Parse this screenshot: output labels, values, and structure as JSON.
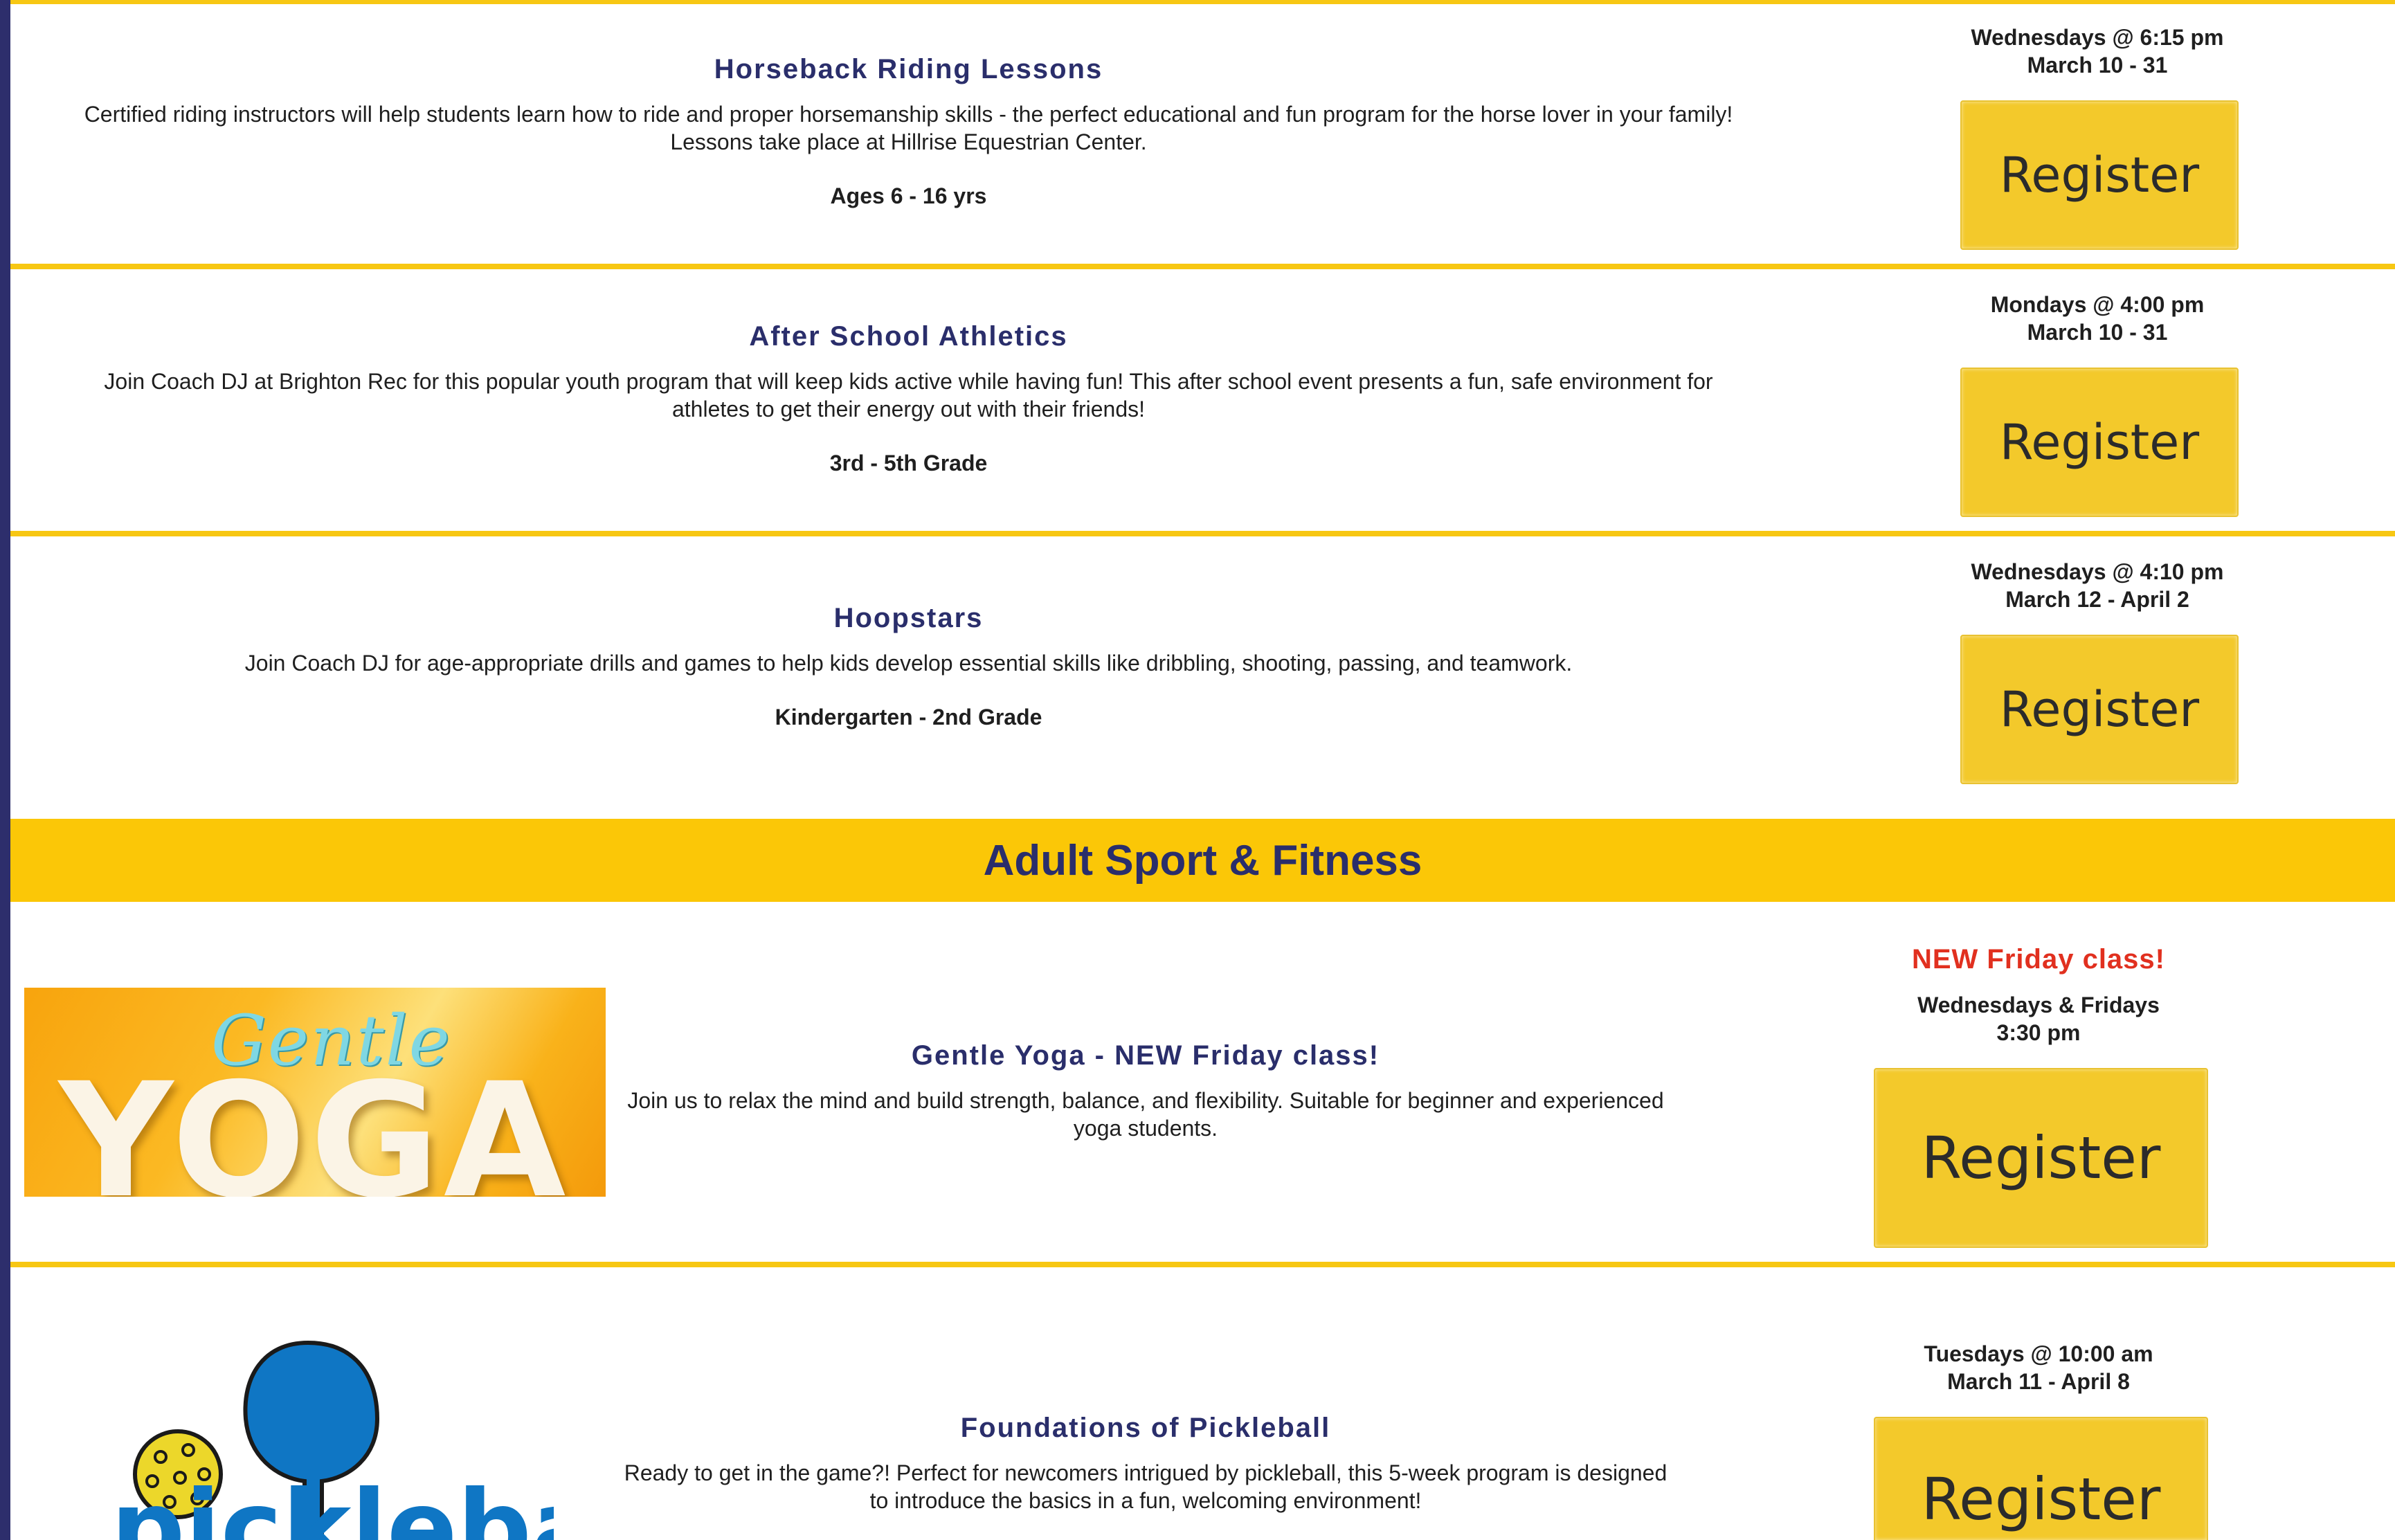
{
  "colors": {
    "accent_yellow": "#f7c713",
    "navy": "#2a2e6b",
    "red": "#e1301f",
    "button": "#f3c92b"
  },
  "programs": [
    {
      "title": "Horseback Riding Lessons",
      "description": "Certified riding instructors will help students learn how to ride and proper horsemanship skills - the perfect educational and fun program for the horse lover in your family! Lessons take place at Hillrise Equestrian Center.",
      "age": "Ages 6 - 16 yrs",
      "schedule_line1": "Wednesdays @ 6:15 pm",
      "schedule_line2": "March 10 - 31",
      "button_label": "Register"
    },
    {
      "title": "After School Athletics",
      "description": "Join Coach DJ at Brighton Rec for this popular youth program that will keep kids active while having fun! This after school event presents a fun, safe environment for athletes to get their energy out with their friends!",
      "age": "3rd - 5th Grade",
      "schedule_line1": "Mondays @ 4:00 pm",
      "schedule_line2": "March 10 - 31",
      "button_label": "Register"
    },
    {
      "title": "Hoopstars",
      "description": "Join Coach DJ for age-appropriate drills and games to help kids develop essential skills like dribbling, shooting, passing, and teamwork.",
      "age": "Kindergarten - 2nd Grade",
      "schedule_line1": "Wednesdays @ 4:10 pm",
      "schedule_line2": "March 12 - April 2",
      "button_label": "Register"
    }
  ],
  "section": {
    "title": "Adult Sport & Fitness"
  },
  "yoga": {
    "image_word1": "Gentle",
    "image_word2": "YOGA",
    "title": "Gentle Yoga - NEW Friday class!",
    "description": "Join us to relax the mind and build strength, balance, and flexibility. Suitable for beginner and experienced yoga students.",
    "new_label": "NEW Friday class!",
    "schedule_line1": "Wednesdays & Fridays",
    "schedule_line2": "3:30 pm",
    "button_label": "Register"
  },
  "pickleball": {
    "title": "Foundations of Pickleball",
    "description": "Ready to get in the game?! Perfect for newcomers intrigued by pickleball, this 5-week program is designed to introduce the basics in a fun, welcoming environment!",
    "schedule_line1": "Tuesdays @ 10:00 am",
    "schedule_line2": "March 11 - April 8",
    "button_label": "Register",
    "logo_text": "pickleball"
  }
}
